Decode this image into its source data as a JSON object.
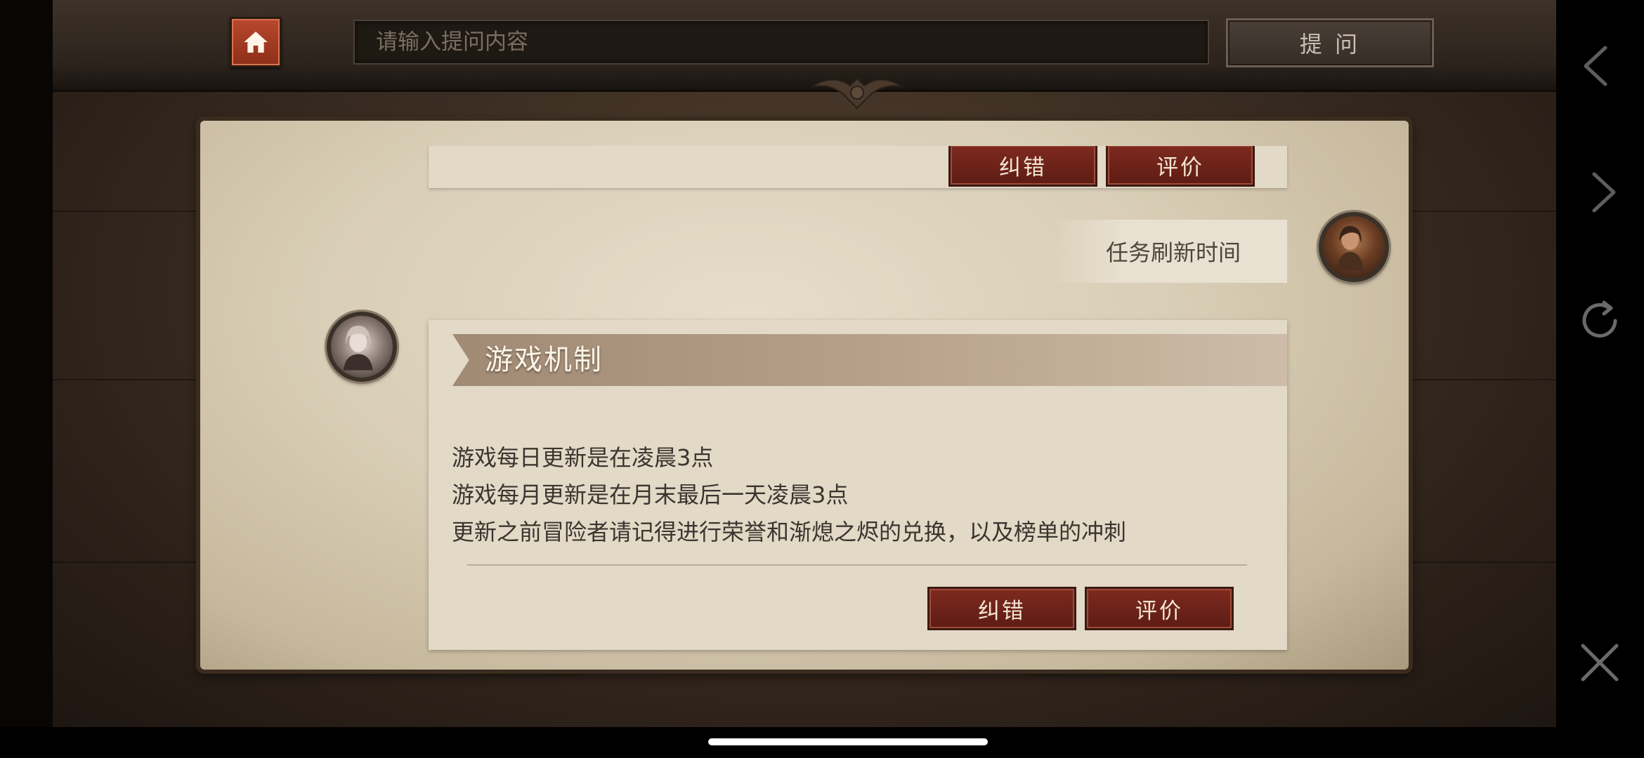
{
  "top_bar": {
    "search_placeholder": "请输入提问内容",
    "ask_label": "提 问"
  },
  "previous_card": {
    "correct_label": "纠错",
    "rate_label": "评价"
  },
  "question": {
    "text": "任务刷新时间"
  },
  "answer": {
    "title": "游戏机制",
    "lines": [
      "游戏每日更新是在凌晨3点",
      "游戏每月更新是在月末最后一天凌晨3点",
      "更新之前冒险者请记得进行荣誉和渐熄之烬的兑换，以及榜单的冲刺"
    ],
    "correct_label": "纠错",
    "rate_label": "评价"
  },
  "icons": {
    "home": "home-icon",
    "back": "chevron-left-icon",
    "forward": "chevron-right-icon",
    "refresh": "refresh-icon",
    "close": "close-icon"
  },
  "colors": {
    "button_red": "#7e2a1f",
    "parchment": "#e2d9c6",
    "title_bar": "#a18a74"
  }
}
